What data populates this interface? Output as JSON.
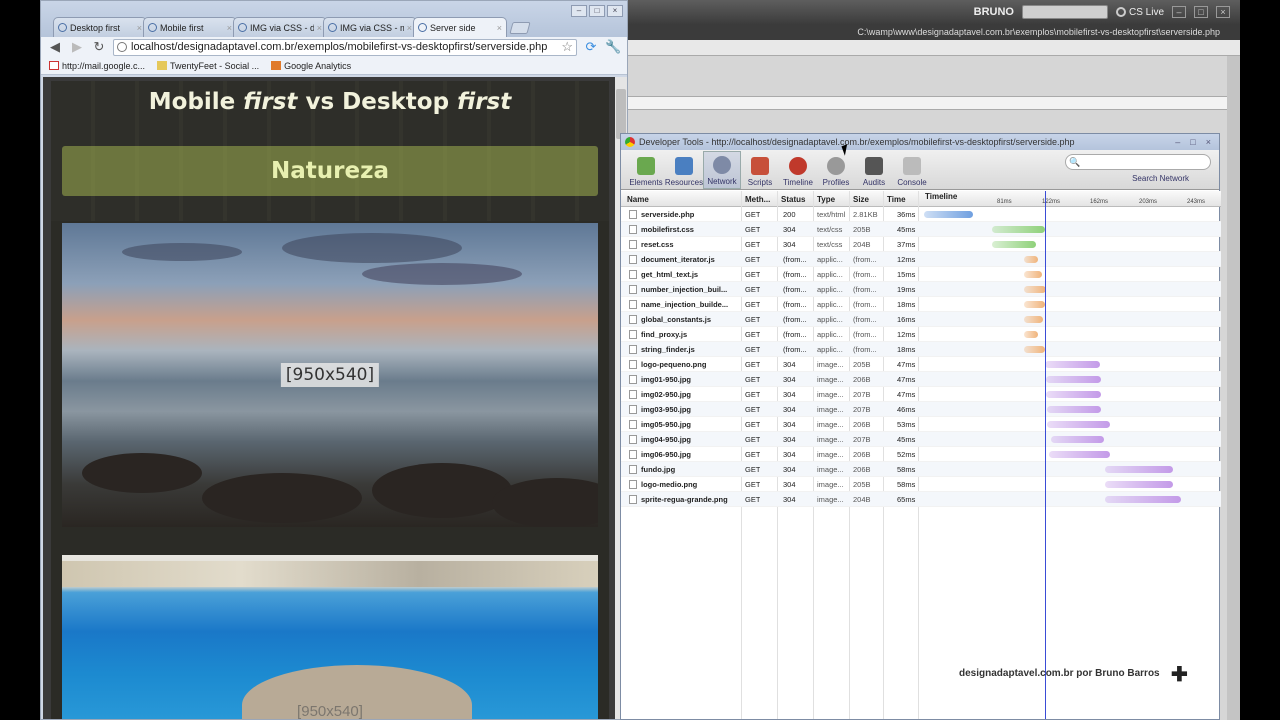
{
  "background_app": {
    "user": "BRUNO",
    "search_placeholder": "",
    "cs_live": "CS Live",
    "path": "C:\\wamp\\www\\designadaptavel.com.br\\exemplos\\mobilefirst-vs-desktopfirst\\serverside.php"
  },
  "browser": {
    "tabs": [
      {
        "label": "Desktop first"
      },
      {
        "label": "Mobile first"
      },
      {
        "label": "IMG via CSS - de"
      },
      {
        "label": "IMG via CSS - m"
      },
      {
        "label": "Server side"
      }
    ],
    "url": "localhost/designadaptavel.com.br/exemplos/mobilefirst-vs-desktopfirst/serverside.php",
    "bookmarks": [
      {
        "label": "http://mail.google.c..."
      },
      {
        "label": "TwentyFeet - Social ..."
      },
      {
        "label": "Google Analytics"
      }
    ]
  },
  "page": {
    "title_part1": "Mobile ",
    "title_em1": "first",
    "title_part2": " vs Desktop ",
    "title_em2": "first",
    "section": "Natureza",
    "image1_label": "[950x540]",
    "image2_label": "[950x540]"
  },
  "devtools": {
    "title": "Developer Tools - http://localhost/designadaptavel.com.br/exemplos/mobilefirst-vs-desktopfirst/serverside.php",
    "tools": [
      {
        "label": "Elements",
        "color": "#6aa84f"
      },
      {
        "label": "Resources",
        "color": "#4a7fc1"
      },
      {
        "label": "Network",
        "color": "#7e8aa6"
      },
      {
        "label": "Scripts",
        "color": "#c7503a"
      },
      {
        "label": "Timeline",
        "color": "#c0392b"
      },
      {
        "label": "Profiles",
        "color": "#999999"
      },
      {
        "label": "Audits",
        "color": "#555555"
      },
      {
        "label": "Console",
        "color": "#bbbbbb"
      }
    ],
    "active_tool": "Network",
    "search_label": "Search Network",
    "columns": {
      "name": "Name",
      "method": "Meth...",
      "status": "Status",
      "type": "Type",
      "size": "Size",
      "time": "Time",
      "timeline": "Timeline"
    },
    "ticks": [
      "81ms",
      "122ms",
      "162ms",
      "203ms",
      "243ms"
    ],
    "requests": [
      {
        "name": "serverside.php",
        "method": "GET",
        "status": "200",
        "type": "text/html",
        "size": "2.81KB",
        "time": "36ms",
        "start": 0.0,
        "end": 36,
        "color": "#6f9fe0"
      },
      {
        "name": "mobilefirst.css",
        "method": "GET",
        "status": "304",
        "type": "text/css",
        "size": "205B",
        "time": "45ms",
        "start": 77,
        "end": 122,
        "color": "#8fd17a"
      },
      {
        "name": "reset.css",
        "method": "GET",
        "status": "304",
        "type": "text/css",
        "size": "204B",
        "time": "37ms",
        "start": 77,
        "end": 114,
        "color": "#8fd17a"
      },
      {
        "name": "document_iterator.js",
        "method": "GET",
        "status": "(from...",
        "type": "applic...",
        "size": "(from...",
        "time": "12ms",
        "start": 104,
        "end": 116,
        "color": "#f0b37a"
      },
      {
        "name": "get_html_text.js",
        "method": "GET",
        "status": "(from...",
        "type": "applic...",
        "size": "(from...",
        "time": "15ms",
        "start": 104,
        "end": 119,
        "color": "#f0b37a"
      },
      {
        "name": "number_injection_buil...",
        "method": "GET",
        "status": "(from...",
        "type": "applic...",
        "size": "(from...",
        "time": "19ms",
        "start": 104,
        "end": 123,
        "color": "#f0b37a"
      },
      {
        "name": "name_injection_builde...",
        "method": "GET",
        "status": "(from...",
        "type": "applic...",
        "size": "(from...",
        "time": "18ms",
        "start": 104,
        "end": 122,
        "color": "#f0b37a"
      },
      {
        "name": "global_constants.js",
        "method": "GET",
        "status": "(from...",
        "type": "applic...",
        "size": "(from...",
        "time": "16ms",
        "start": 104,
        "end": 120,
        "color": "#f0b37a"
      },
      {
        "name": "find_proxy.js",
        "method": "GET",
        "status": "(from...",
        "type": "applic...",
        "size": "(from...",
        "time": "12ms",
        "start": 104,
        "end": 116,
        "color": "#f0b37a"
      },
      {
        "name": "string_finder.js",
        "method": "GET",
        "status": "(from...",
        "type": "applic...",
        "size": "(from...",
        "time": "18ms",
        "start": 104,
        "end": 122,
        "color": "#f0b37a"
      },
      {
        "name": "logo-pequeno.png",
        "method": "GET",
        "status": "304",
        "type": "image...",
        "size": "205B",
        "time": "47ms",
        "start": 122,
        "end": 169,
        "color": "#c39ae8"
      },
      {
        "name": "img01-950.jpg",
        "method": "GET",
        "status": "304",
        "type": "image...",
        "size": "206B",
        "time": "47ms",
        "start": 123,
        "end": 170,
        "color": "#c39ae8"
      },
      {
        "name": "img02-950.jpg",
        "method": "GET",
        "status": "304",
        "type": "image...",
        "size": "207B",
        "time": "47ms",
        "start": 123,
        "end": 170,
        "color": "#c39ae8"
      },
      {
        "name": "img03-950.jpg",
        "method": "GET",
        "status": "304",
        "type": "image...",
        "size": "207B",
        "time": "46ms",
        "start": 124,
        "end": 170,
        "color": "#c39ae8"
      },
      {
        "name": "img05-950.jpg",
        "method": "GET",
        "status": "304",
        "type": "image...",
        "size": "206B",
        "time": "53ms",
        "start": 124,
        "end": 177,
        "color": "#c39ae8"
      },
      {
        "name": "img04-950.jpg",
        "method": "GET",
        "status": "304",
        "type": "image...",
        "size": "207B",
        "time": "45ms",
        "start": 127,
        "end": 172,
        "color": "#c39ae8"
      },
      {
        "name": "img06-950.jpg",
        "method": "GET",
        "status": "304",
        "type": "image...",
        "size": "206B",
        "time": "52ms",
        "start": 125,
        "end": 177,
        "color": "#c39ae8"
      },
      {
        "name": "fundo.jpg",
        "method": "GET",
        "status": "304",
        "type": "image...",
        "size": "206B",
        "time": "58ms",
        "start": 173,
        "end": 231,
        "color": "#c39ae8"
      },
      {
        "name": "logo-medio.png",
        "method": "GET",
        "status": "304",
        "type": "image...",
        "size": "205B",
        "time": "58ms",
        "start": 173,
        "end": 231,
        "color": "#c39ae8"
      },
      {
        "name": "sprite-regua-grande.png",
        "method": "GET",
        "status": "304",
        "type": "image...",
        "size": "204B",
        "time": "65ms",
        "start": 173,
        "end": 238,
        "color": "#c39ae8"
      }
    ],
    "marker_ms": 122,
    "credit_site": "designadaptavel.com.br",
    "credit_por": "por",
    "credit_author": "Bruno Barros"
  }
}
